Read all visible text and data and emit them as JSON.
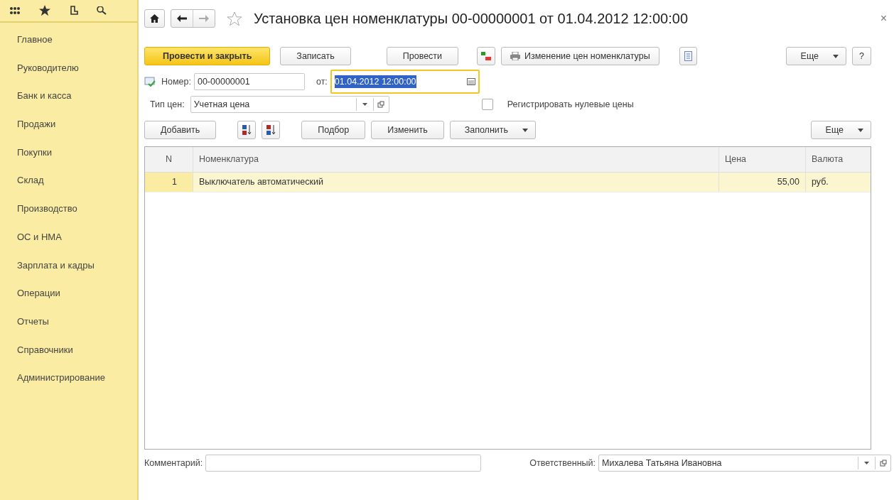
{
  "sidebar": {
    "items": [
      {
        "label": "Главное"
      },
      {
        "label": "Руководителю"
      },
      {
        "label": "Банк и касса"
      },
      {
        "label": "Продажи"
      },
      {
        "label": "Покупки"
      },
      {
        "label": "Склад"
      },
      {
        "label": "Производство"
      },
      {
        "label": "ОС и НМА"
      },
      {
        "label": "Зарплата и кадры"
      },
      {
        "label": "Операции"
      },
      {
        "label": "Отчеты"
      },
      {
        "label": "Справочники"
      },
      {
        "label": "Администрирование"
      }
    ]
  },
  "window": {
    "title": "Установка цен номенклатуры 00-00000001 от 01.04.2012 12:00:00",
    "close": "×"
  },
  "command_bar": [
    {
      "kind": "primary",
      "label": "Провести и закрыть"
    },
    {
      "kind": "plain",
      "label": "Записать"
    },
    {
      "kind": "plain",
      "label": "Провести"
    },
    {
      "kind": "dtkt"
    },
    {
      "kind": "print",
      "label": "Изменение цен номенклатуры"
    },
    {
      "kind": "doc"
    },
    {
      "kind": "dropdown",
      "label": "Еще"
    },
    {
      "kind": "plain",
      "label": "?"
    }
  ],
  "number": {
    "label": "Номер:",
    "value": "00-00000001"
  },
  "date": {
    "label": "от:",
    "value": "01.04.2012 12:00:00",
    "focused": true
  },
  "price_type": {
    "label": "Тип цен:",
    "value": "Учетная цена"
  },
  "zero_prices": {
    "label": "Регистрировать нулевые цены",
    "checked": false
  },
  "table_toolbar": [
    {
      "kind": "plain",
      "label": "Добавить"
    },
    {
      "kind": "sort_asc"
    },
    {
      "kind": "sort_desc"
    },
    {
      "kind": "plain",
      "label": "Подбор"
    },
    {
      "kind": "plain",
      "label": "Изменить"
    },
    {
      "kind": "dropdown",
      "label": "Заполнить"
    },
    {
      "kind": "dropdown",
      "label": "Еще"
    }
  ],
  "table": {
    "columns": [
      "N",
      "Номенклатура",
      "Цена",
      "Валюта"
    ],
    "rows": [
      {
        "cells": [
          "1",
          "Выключатель автоматический",
          "55,00",
          "руб."
        ],
        "selected": true
      }
    ]
  },
  "comment": {
    "label": "Комментарий:"
  },
  "responsible": {
    "label": "Ответственный:",
    "value": "Михалева Татьяна Ивановна"
  }
}
